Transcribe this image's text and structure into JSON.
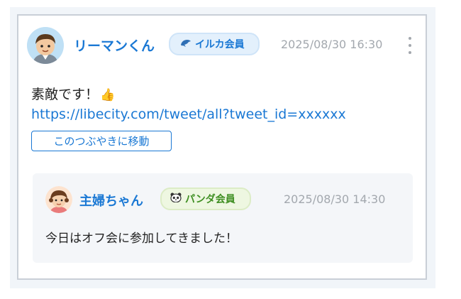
{
  "post": {
    "author": "リーマンくん",
    "badge": "イルカ会員",
    "timestamp": "2025/08/30 16:30",
    "text": "素敵です！",
    "emoji": "👍",
    "link": "https://libecity.com/tweet/all?tweet_id=xxxxxx",
    "move_button": "このつぶやきに移動"
  },
  "quoted": {
    "author": "主婦ちゃん",
    "badge": "パンダ会員",
    "timestamp": "2025/08/30 14:30",
    "text": "今日はオフ会に参加してきました！"
  },
  "icons": {
    "more": "more-vertical-icon",
    "dolphin": "dolphin-icon",
    "panda": "panda-icon"
  },
  "colors": {
    "accent": "#1a78d4",
    "badge_blue_bg": "#e3f0fc",
    "badge_green_bg": "#eef7e1",
    "badge_green_text": "#3f8f22",
    "muted": "#a3a8ae"
  }
}
